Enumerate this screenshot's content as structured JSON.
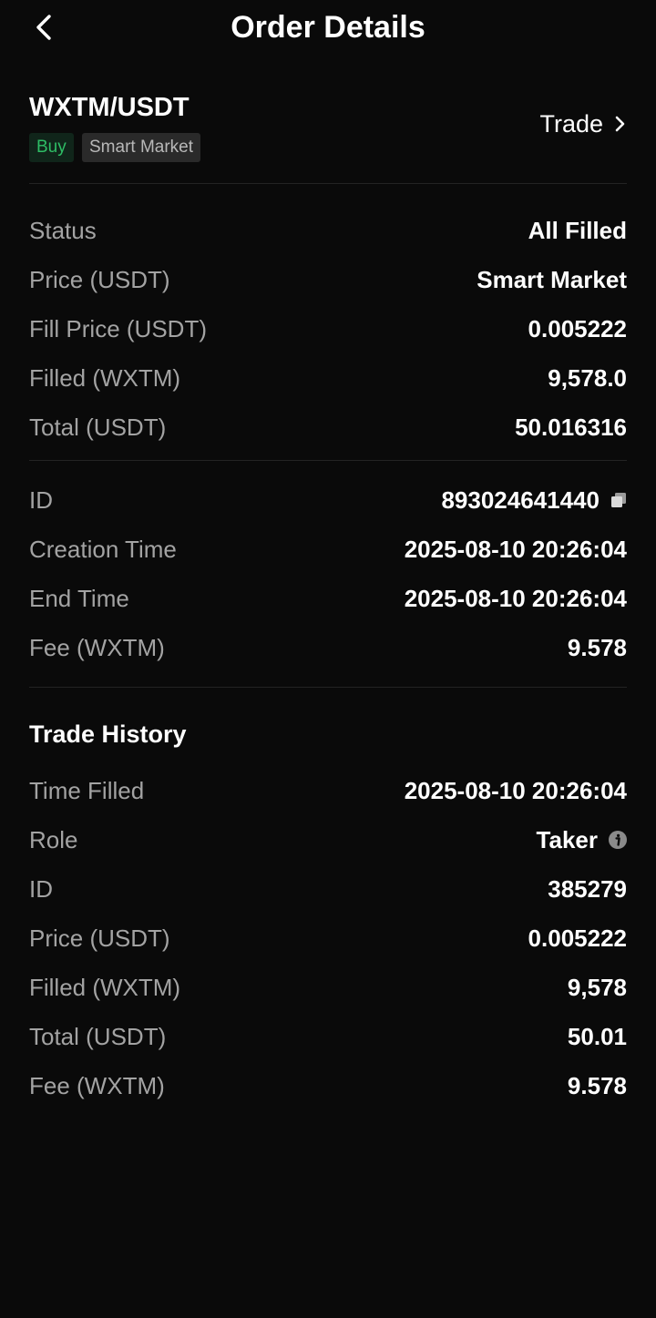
{
  "header": {
    "title": "Order Details",
    "back_icon": "chevron-left-icon"
  },
  "pair": {
    "name": "WXTM/USDT",
    "side": "Buy",
    "order_type": "Smart Market",
    "trade_label": "Trade",
    "colors": {
      "buy": "#2ebd65",
      "buy_bg": "#10251a"
    }
  },
  "summary": [
    {
      "label": "Status",
      "value": "All Filled"
    },
    {
      "label": "Price (USDT)",
      "value": "Smart Market"
    },
    {
      "label": "Fill Price (USDT)",
      "value": "0.005222"
    },
    {
      "label": "Filled (WXTM)",
      "value": "9,578.0"
    },
    {
      "label": "Total (USDT)",
      "value": "50.016316"
    }
  ],
  "details": [
    {
      "label": "ID",
      "value": "893024641440",
      "icon": "copy-icon"
    },
    {
      "label": "Creation Time",
      "value": "2025-08-10 20:26:04"
    },
    {
      "label": "End Time",
      "value": "2025-08-10 20:26:04"
    },
    {
      "label": "Fee (WXTM)",
      "value": "9.578"
    }
  ],
  "trade_history": {
    "title": "Trade History",
    "rows": [
      {
        "label": "Time Filled",
        "value": "2025-08-10 20:26:04"
      },
      {
        "label": "Role",
        "value": "Taker",
        "icon": "info-icon"
      },
      {
        "label": "ID",
        "value": "385279"
      },
      {
        "label": "Price (USDT)",
        "value": "0.005222"
      },
      {
        "label": "Filled (WXTM)",
        "value": "9,578"
      },
      {
        "label": "Total (USDT)",
        "value": "50.01"
      },
      {
        "label": "Fee (WXTM)",
        "value": "9.578"
      }
    ]
  }
}
